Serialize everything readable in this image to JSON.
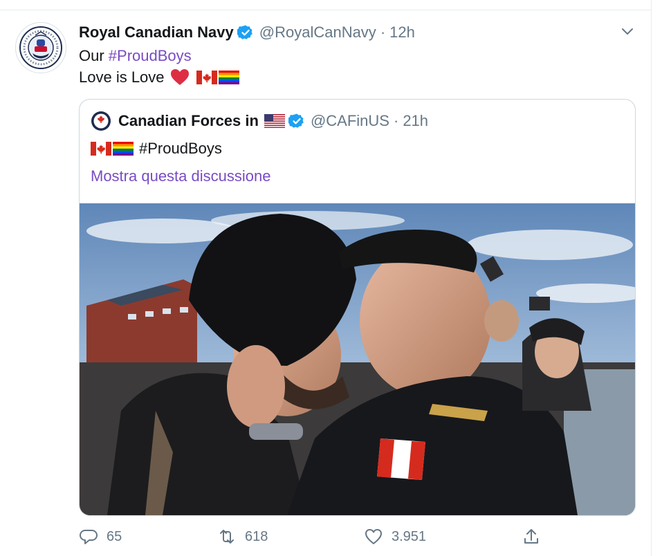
{
  "tweet": {
    "author_name": "Royal Canadian Navy",
    "author_handle": "@RoyalCanNavy",
    "separator": "·",
    "time": "12h",
    "line1_prefix": "Our ",
    "line1_hashtag": "#ProudBoys",
    "line2_text": "Love is Love"
  },
  "quoted_tweet": {
    "author_name": "Canadian Forces in",
    "author_handle": "@CAFinUS",
    "separator": "·",
    "time": "21h",
    "body_hashtag": "#ProudBoys",
    "show_thread_link": "Mostra questa discussione"
  },
  "actions": {
    "reply_count": "65",
    "retweet_count": "618",
    "like_count": "3.951"
  },
  "icons": {
    "verified": "verified-badge-icon",
    "caret": "chevron-down-icon",
    "reply": "reply-icon",
    "retweet": "retweet-icon",
    "like": "heart-icon",
    "share": "share-icon"
  },
  "colors": {
    "hashtag": "#794bc4",
    "verified": "#1da1f2",
    "muted_text": "#657786",
    "border": "#ccd6dd"
  }
}
